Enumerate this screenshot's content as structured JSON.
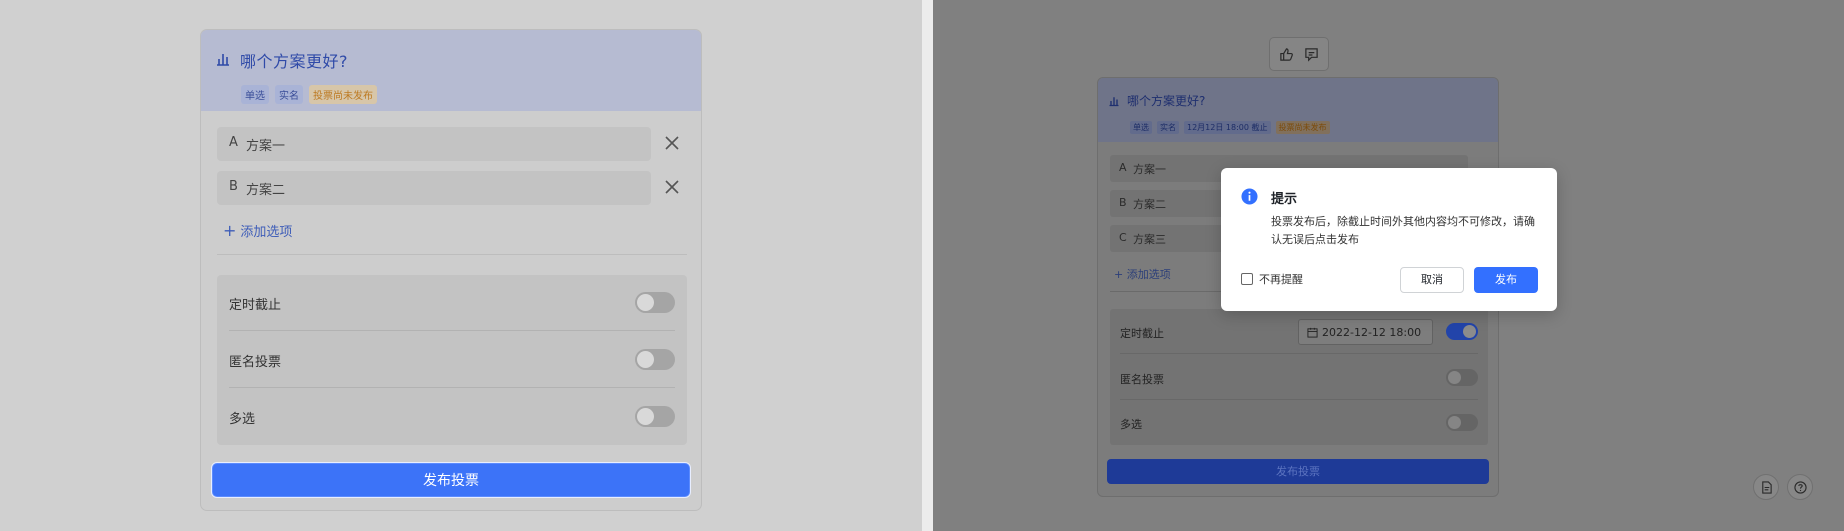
{
  "left": {
    "poll": {
      "title": "哪个方案更好?",
      "tags": [
        "单选",
        "实名"
      ],
      "status_tag": "投票尚未发布",
      "options": [
        {
          "letter": "A",
          "text": "方案一"
        },
        {
          "letter": "B",
          "text": "方案二"
        }
      ],
      "add_option_label": "添加选项",
      "settings": [
        {
          "label": "定时截止",
          "enabled": false
        },
        {
          "label": "匿名投票",
          "enabled": false
        },
        {
          "label": "多选",
          "enabled": false
        }
      ],
      "publish_label": "发布投票"
    }
  },
  "right": {
    "toolbar": {
      "icons": [
        "thumbs-up-icon",
        "comment-icon"
      ]
    },
    "poll": {
      "title": "哪个方案更好?",
      "tags": [
        "单选",
        "实名",
        "12月12日 18:00 截止"
      ],
      "status_tag": "投票尚未发布",
      "options": [
        {
          "letter": "A",
          "text": "方案一"
        },
        {
          "letter": "B",
          "text": "方案二"
        },
        {
          "letter": "C",
          "text": "方案三"
        }
      ],
      "add_option_label": "添加选项",
      "settings": [
        {
          "label": "定时截止",
          "enabled": true,
          "date": "2022-12-12 18:00"
        },
        {
          "label": "匿名投票",
          "enabled": false
        },
        {
          "label": "多选",
          "enabled": false
        }
      ],
      "publish_label": "发布投票"
    },
    "dialog": {
      "title": "提示",
      "body": "投票发布后，除截止时间外其他内容均不可修改，请确认无误后点击发布",
      "checkbox_label": "不再提醒",
      "cancel_label": "取消",
      "confirm_label": "发布"
    }
  },
  "colors": {
    "primary": "#3370ff",
    "warning": "#c77a1d",
    "overlay": "#808080"
  }
}
